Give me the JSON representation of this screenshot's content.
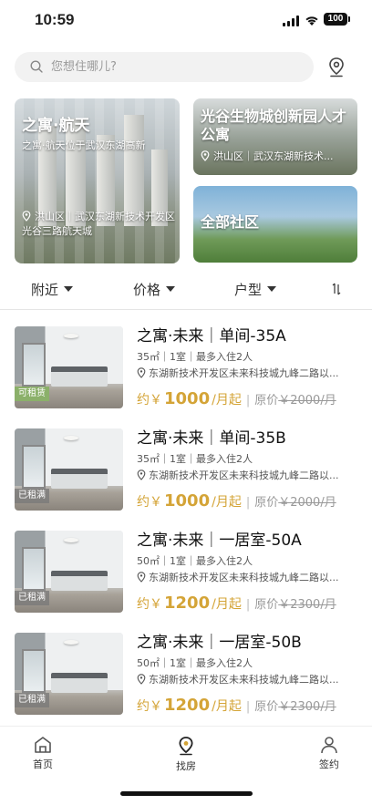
{
  "status": {
    "time": "10:59",
    "battery": "100"
  },
  "search": {
    "placeholder": "您想住哪儿?"
  },
  "featured": [
    {
      "title": "之寓·航天",
      "subtitle": "之寓·航天位于武汉东湖高新",
      "location": "洪山区｜武汉东湖新技术开发区光谷三路航天城"
    },
    {
      "title": "光谷生物城创新园人才公寓",
      "location": "洪山区｜武汉东湖新技术..."
    },
    {
      "title": "全部社区"
    }
  ],
  "filters": {
    "nearby": "附近",
    "price": "价格",
    "layout": "户型"
  },
  "listings": [
    {
      "name": "之寓·未来｜单间-35A",
      "meta": "35㎡｜1室｜最多入住2人",
      "address": "东湖新技术开发区未来科技城九峰二路以...",
      "prefix": "约￥",
      "price": "1000",
      "unit": "/月起",
      "orig_label": "原价",
      "orig_price": "￥2000/月",
      "tag": "可租赁",
      "tag_color": "#8bb06a"
    },
    {
      "name": "之寓·未来｜单间-35B",
      "meta": "35㎡｜1室｜最多入住2人",
      "address": "东湖新技术开发区未来科技城九峰二路以...",
      "prefix": "约￥",
      "price": "1000",
      "unit": "/月起",
      "orig_label": "原价",
      "orig_price": "￥2000/月",
      "tag": "已租满",
      "tag_color": "rgba(120,120,120,0.75)"
    },
    {
      "name": "之寓·未来｜一居室-50A",
      "meta": "50㎡｜1室｜最多入住2人",
      "address": "东湖新技术开发区未来科技城九峰二路以...",
      "prefix": "约￥",
      "price": "1200",
      "unit": "/月起",
      "orig_label": "原价",
      "orig_price": "￥2300/月",
      "tag": "已租满",
      "tag_color": "rgba(120,120,120,0.75)"
    },
    {
      "name": "之寓·未来｜一居室-50B",
      "meta": "50㎡｜1室｜最多入住2人",
      "address": "东湖新技术开发区未来科技城九峰二路以...",
      "prefix": "约￥",
      "price": "1200",
      "unit": "/月起",
      "orig_label": "原价",
      "orig_price": "￥2300/月",
      "tag": "已租满",
      "tag_color": "rgba(120,120,120,0.75)"
    }
  ],
  "tabbar": {
    "home": "首页",
    "find": "找房",
    "sign": "签约"
  },
  "colors": {
    "accent": "#d4a437",
    "available": "#8bb06a"
  }
}
